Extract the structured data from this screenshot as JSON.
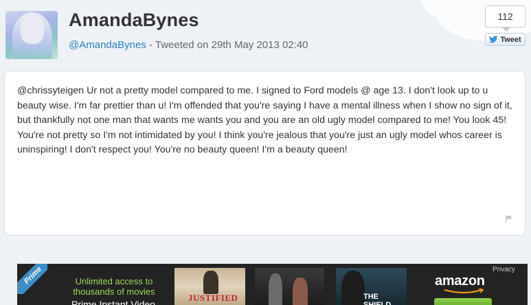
{
  "header": {
    "name": "AmandaBynes",
    "handle": "@AmandaBynes",
    "tweeted_on": " - Tweeted on 29th May 2013 02:40"
  },
  "share": {
    "count": "112",
    "tweet_label": "Tweet"
  },
  "tweet": {
    "text": "@chrissyteigen Ur not a pretty model compared to me. I signed to Ford models @ age 13. I don't look up to u beauty wise. I'm far prettier than u! I'm offended that you're saying I have a mental illness when I show no sign of it, but thankfully not one man that wants me wants you and you are an old ugly model compared to me! You look 45! You're not pretty so I'm not intimidated by you! I think you're jealous that you're just an ugly model whos career is uninspiring! I don't respect you! You're no beauty queen! I'm a beauty queen!"
  },
  "ad": {
    "prime_label": "Prime",
    "line1": "Unlimited access to thousands of movies",
    "line2": "Prime Instant Video",
    "poster1_title": "JUSTIFIED",
    "poster3_title": "THE SHIELD",
    "amazon_logo": "amazon",
    "privacy": "Privacy"
  },
  "colors": {
    "handle_link": "#2a7fb8",
    "ad_accent": "#9bd85a",
    "background": "#eef2f7"
  }
}
